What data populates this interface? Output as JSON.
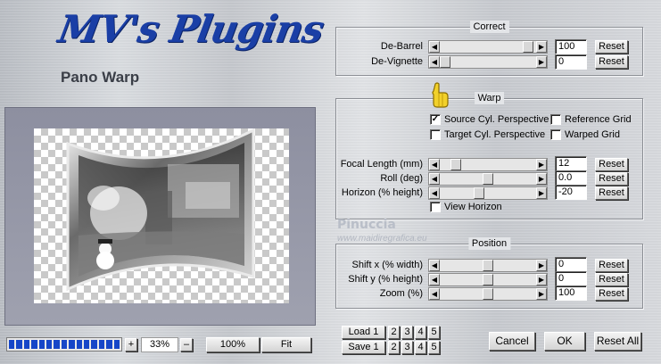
{
  "header": {
    "logo_text": "MV's Plugins",
    "plugin_name": "Pano Warp"
  },
  "preview": {
    "zoom_in": "+",
    "zoom_value": "33%",
    "zoom_out": "–",
    "btn_100": "100%",
    "btn_fit": "Fit",
    "progress_segments": 15
  },
  "correct": {
    "title": "Correct",
    "rows": [
      {
        "label": "De-Barrel",
        "value": "100",
        "reset": "Reset",
        "thumb": 0.97
      },
      {
        "label": "De-Vignette",
        "value": "0",
        "reset": "Reset",
        "thumb": 0.0
      }
    ]
  },
  "warp": {
    "title": "Warp",
    "checks": [
      {
        "label": "Source Cyl. Perspective",
        "checked": true
      },
      {
        "label": "Reference Grid",
        "checked": false
      },
      {
        "label": "Target Cyl. Perspective",
        "checked": false
      },
      {
        "label": "Warped Grid",
        "checked": false
      }
    ],
    "rows": [
      {
        "label": "Focal Length (mm)",
        "value": "12",
        "reset": "Reset",
        "thumb": 0.12
      },
      {
        "label": "Roll (deg)",
        "value": "0.0",
        "reset": "Reset",
        "thumb": 0.5
      },
      {
        "label": "Horizon (% height)",
        "value": "-20",
        "reset": "Reset",
        "thumb": 0.4
      }
    ],
    "view_horizon": {
      "label": "View Horizon",
      "checked": false
    }
  },
  "watermark": {
    "name": "Pinuccia",
    "site": "www.maidiregrafica.eu"
  },
  "position": {
    "title": "Position",
    "rows": [
      {
        "label": "Shift x (% width)",
        "value": "0",
        "reset": "Reset",
        "thumb": 0.5
      },
      {
        "label": "Shift y (% height)",
        "value": "0",
        "reset": "Reset",
        "thumb": 0.5
      },
      {
        "label": "Zoom (%)",
        "value": "100",
        "reset": "Reset",
        "thumb": 0.5
      }
    ]
  },
  "presets": {
    "load_label": "Load 1",
    "save_label": "Save 1",
    "slots": [
      "2",
      "3",
      "4",
      "5"
    ]
  },
  "footer": {
    "cancel": "Cancel",
    "ok": "OK",
    "reset_all": "Reset All"
  }
}
